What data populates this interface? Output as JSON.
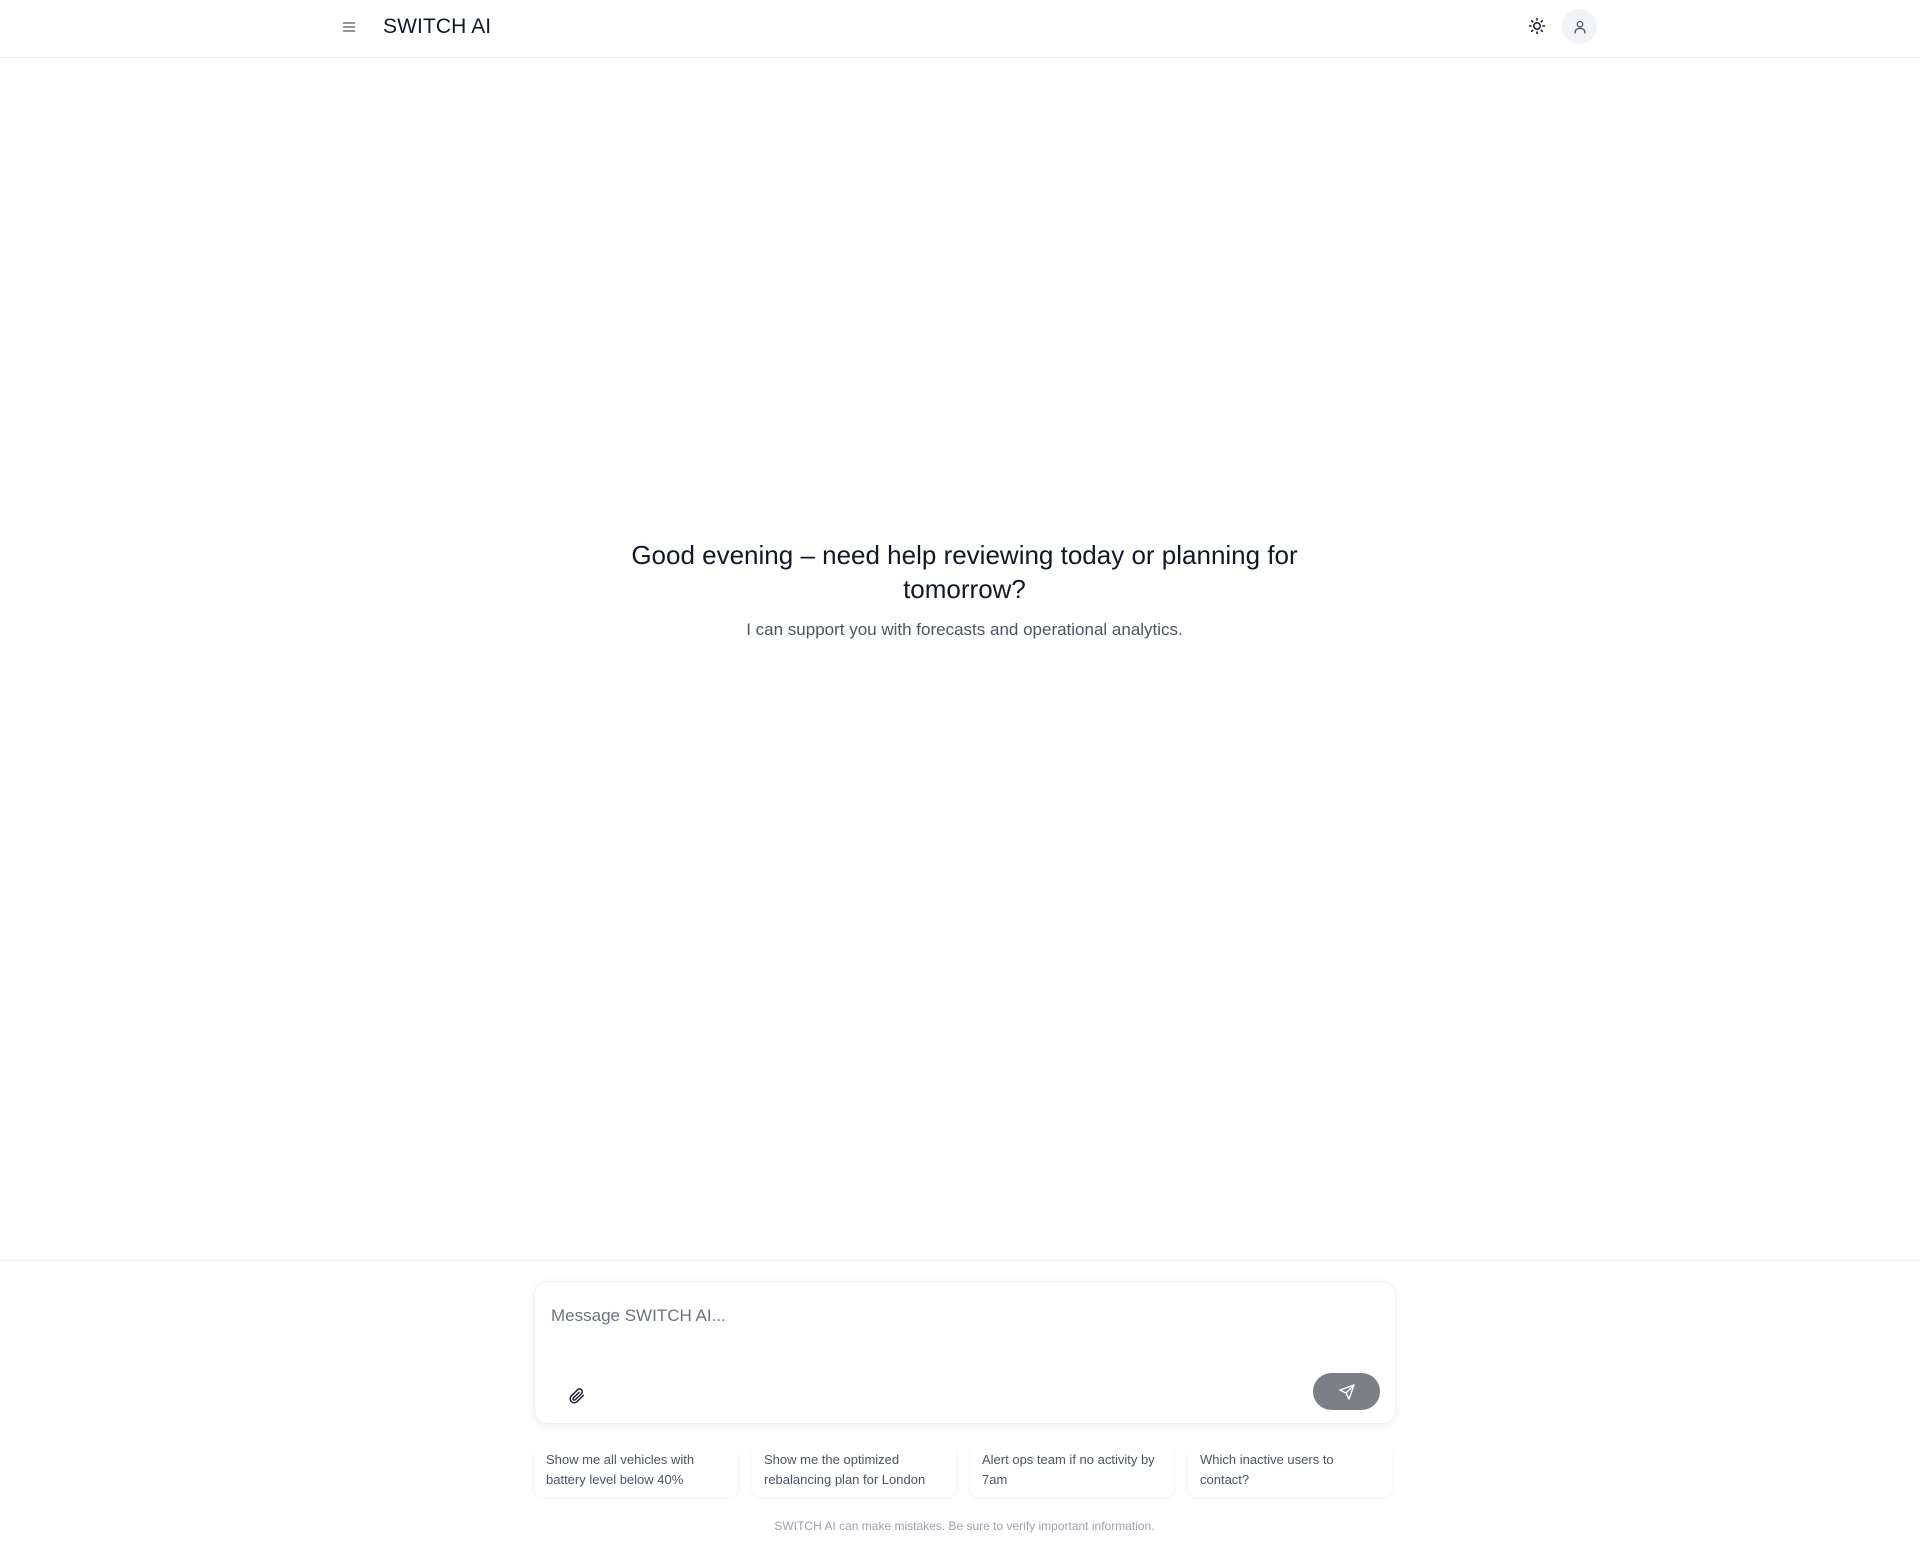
{
  "header": {
    "app_title": "SWITCH AI",
    "menu_icon": "hamburger-menu-icon",
    "theme_icon": "sun-icon",
    "avatar_icon": "user-icon"
  },
  "greeting": {
    "title": "Good evening – need help reviewing today or planning for tomorrow?",
    "subtitle": "I can support you with forecasts and operational analytics."
  },
  "composer": {
    "placeholder": "Message SWITCH AI...",
    "value": "",
    "attach_icon": "paperclip-icon",
    "send_icon": "send-icon"
  },
  "suggestions": [
    {
      "label": "Show me all vehicles with battery level below 40%"
    },
    {
      "label": "Show me the optimized rebalancing plan for London"
    },
    {
      "label": "Alert ops team if no activity by 7am"
    },
    {
      "label": "Which inactive users to contact?"
    }
  ],
  "footer": {
    "disclaimer": "SWITCH AI can make mistakes. Be sure to verify important information."
  },
  "colors": {
    "send_button": "#7b7f87",
    "avatar_bg": "#f1f3f6",
    "border": "#eceef1"
  }
}
